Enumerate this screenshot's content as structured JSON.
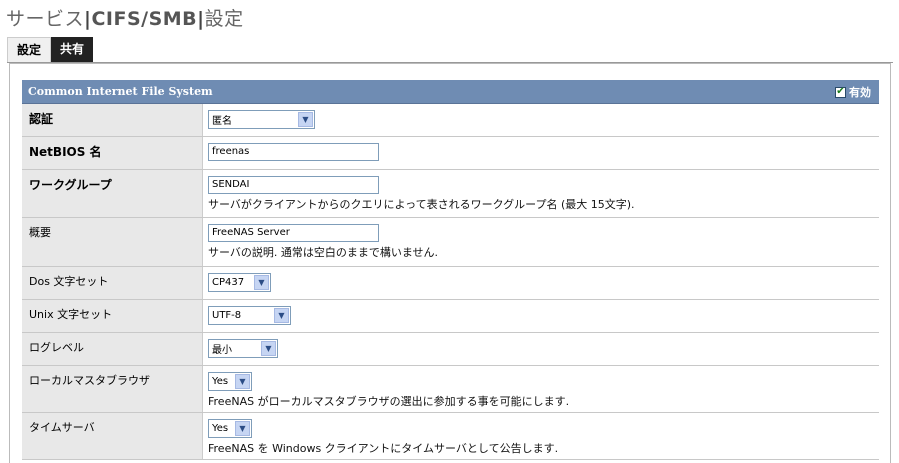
{
  "page": {
    "title_prefix": "サービス",
    "title_sep1": "|",
    "title_mid": "CIFS/SMB",
    "title_sep2": "|",
    "title_suffix": "設定"
  },
  "tabs": [
    {
      "label": "設定",
      "active": true
    },
    {
      "label": "共有",
      "active": false
    }
  ],
  "section": {
    "title": "Common Internet File System",
    "enable_label": "有効",
    "enabled": true
  },
  "fields": {
    "auth": {
      "label": "認証",
      "value": "匿名"
    },
    "netbios": {
      "label": "NetBIOS 名",
      "value": "freenas"
    },
    "workgroup": {
      "label": "ワークグループ",
      "value": "SENDAI",
      "desc": "サーバがクライアントからのクエリによって表されるワークグループ名 (最大 15文字)."
    },
    "description": {
      "label": "概要",
      "value": "FreeNAS Server",
      "desc": "サーバの説明. 通常は空白のままで構いません."
    },
    "dos_charset": {
      "label": "Dos 文字セット",
      "value": "CP437"
    },
    "unix_charset": {
      "label": "Unix 文字セット",
      "value": "UTF-8"
    },
    "log_level": {
      "label": "ログレベル",
      "value": "最小"
    },
    "local_master": {
      "label": "ローカルマスタブラウザ",
      "value": "Yes",
      "desc": "FreeNAS がローカルマスタブラウザの選出に参加する事を可能にします."
    },
    "time_server": {
      "label": "タイムサーバ",
      "value": "Yes",
      "desc": "FreeNAS を Windows クライアントにタイムサーバとして公告します."
    }
  },
  "colors": {
    "header_bg": "#6f8cb3",
    "label_bg": "#e8e8e8",
    "tab_inactive_bg": "#222222"
  }
}
